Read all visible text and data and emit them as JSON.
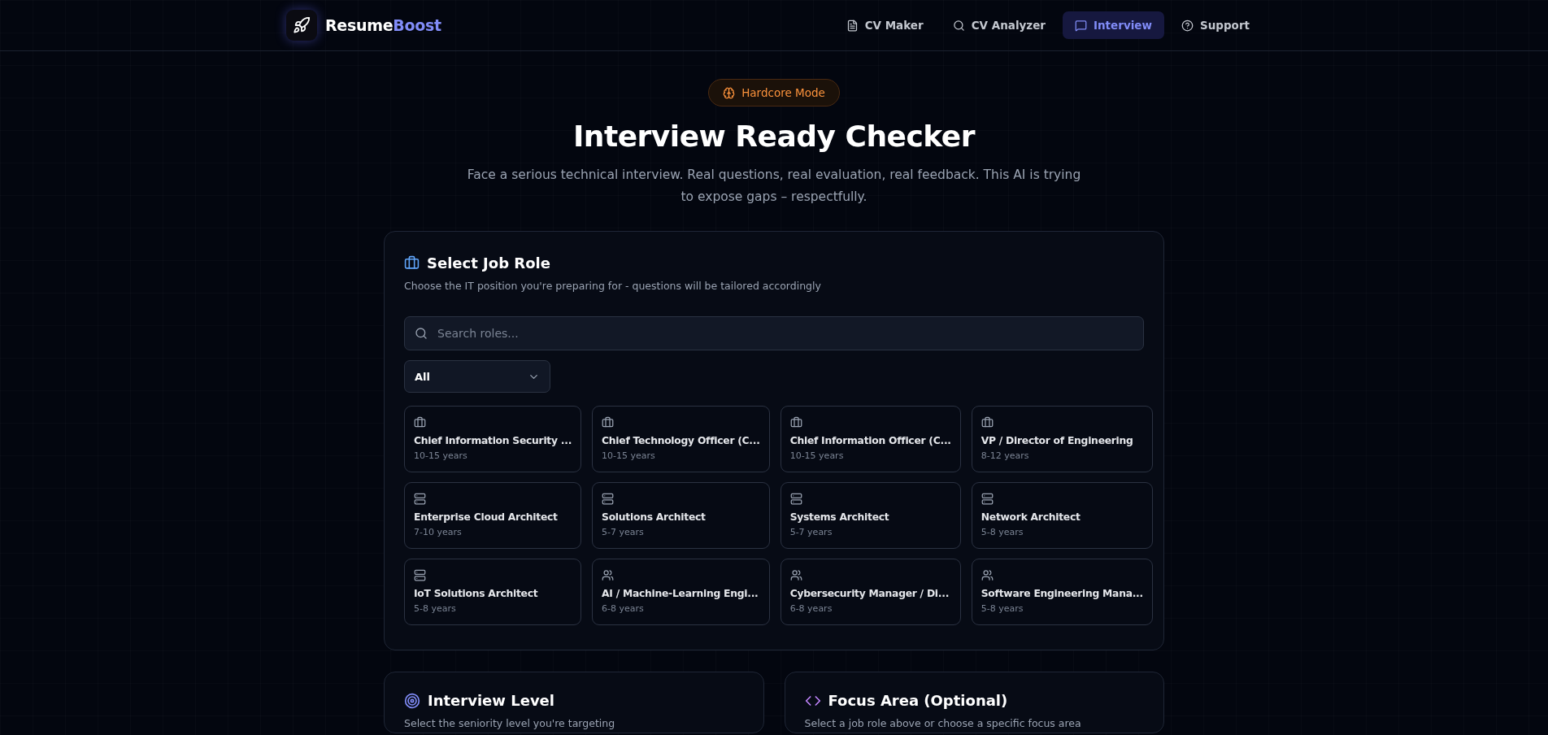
{
  "brand": {
    "first": "Resume",
    "second": "Boost"
  },
  "nav": [
    {
      "label": "CV Maker",
      "kind": "file",
      "selected": false
    },
    {
      "label": "CV Analyzer",
      "kind": "search",
      "selected": false
    },
    {
      "label": "Interview",
      "kind": "chat",
      "selected": true
    },
    {
      "label": "Support",
      "kind": "help",
      "selected": false
    }
  ],
  "badge": "Hardcore Mode",
  "title": "Interview Ready Checker",
  "subtitle": "Face a serious technical interview. Real questions, real evaluation, real feedback. This AI is trying to expose gaps – respectfully.",
  "job_role": {
    "title": "Select Job Role",
    "description": "Choose the IT position you're preparing for - questions will be tailored accordingly",
    "search": {
      "placeholder": "Search roles..."
    },
    "filter": {
      "value": "All"
    },
    "roles": [
      {
        "name": "Chief Information Security ...",
        "years": "10-15 years",
        "kind": "executive"
      },
      {
        "name": "Chief Technology Officer (C...",
        "years": "10-15 years",
        "kind": "executive"
      },
      {
        "name": "Chief Information Officer (C...",
        "years": "10-15 years",
        "kind": "executive"
      },
      {
        "name": "VP / Director of Engineering",
        "years": "8-12 years",
        "kind": "executive"
      },
      {
        "name": "Enterprise Cloud Architect",
        "years": "7-10 years",
        "kind": "architect"
      },
      {
        "name": "Solutions Architect",
        "years": "5-7 years",
        "kind": "architect"
      },
      {
        "name": "Systems Architect",
        "years": "5-7 years",
        "kind": "architect"
      },
      {
        "name": "Network Architect",
        "years": "5-8 years",
        "kind": "architect"
      },
      {
        "name": "IoT Solutions Architect",
        "years": "5-8 years",
        "kind": "architect"
      },
      {
        "name": "AI / Machine-Learning Engi...",
        "years": "6-8 years",
        "kind": "manager"
      },
      {
        "name": "Cybersecurity Manager / Di...",
        "years": "6-8 years",
        "kind": "manager"
      },
      {
        "name": "Software Engineering Mana...",
        "years": "5-8 years",
        "kind": "manager"
      }
    ]
  },
  "panels": [
    {
      "kind": "level",
      "title": "Interview Level",
      "description": "Select the seniority level you're targeting"
    },
    {
      "kind": "focus",
      "title": "Focus Area (Optional)",
      "description": "Select a job role above or choose a specific focus area"
    }
  ]
}
